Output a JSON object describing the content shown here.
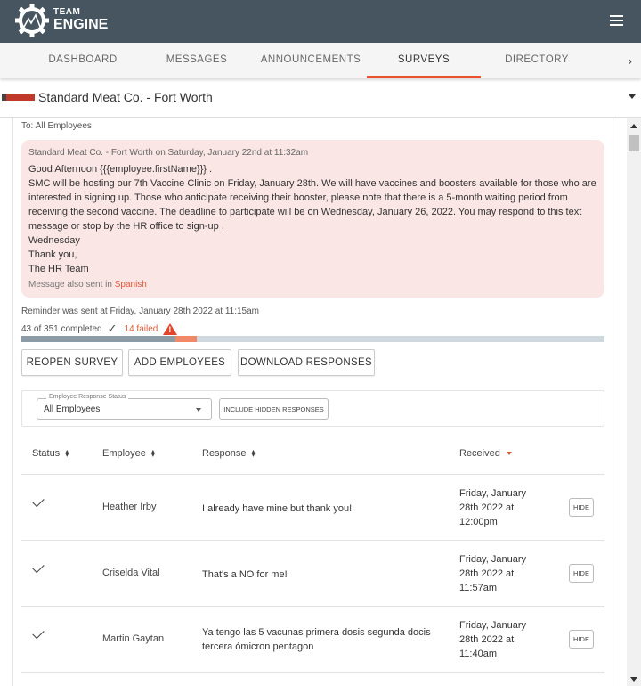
{
  "header": {
    "logo_line1": "TEAM",
    "logo_line2": "ENGINE",
    "menu_icon": "hamburger-icon"
  },
  "tabs": [
    {
      "label": "DASHBOARD",
      "active": false
    },
    {
      "label": "MESSAGES",
      "active": false
    },
    {
      "label": "ANNOUNCEMENTS",
      "active": false
    },
    {
      "label": "SURVEYS",
      "active": true
    },
    {
      "label": "DIRECTORY",
      "active": false
    }
  ],
  "tab_next_label": "›",
  "company": {
    "name": "Standard Meat Co. - Fort Worth"
  },
  "survey": {
    "to": "To: All Employees",
    "message": {
      "meta": "Standard Meat Co. - Fort Worth on Saturday, January 22nd at 11:32am",
      "lines": [
        "Good Afternoon {{{employee.firstName}}} .",
        "SMC will be hosting our 7th Vaccine Clinic on Friday, January 28th. We will have vaccines and boosters available for those who are interested in signing up. Those who anticipate receiving their booster, please note that there is a 5-month waiting period from receiving the second vaccine. The deadline to participate will be on Wednesday, January 26, 2022. You may respond to this text message or stop by the HR office to sign-up .",
        "Wednesday",
        "Thank you,",
        "The HR Team"
      ],
      "also_sent_prefix": "Message also sent in ",
      "also_sent_language": "Spanish"
    },
    "reminder": "Reminder was sent at Friday, January 28th 2022 at 11:15am",
    "completed_text": "43 of 351 completed",
    "failed_text": "14 failed",
    "progress": {
      "completed": 43,
      "failed": 14,
      "total": 351
    },
    "buttons": {
      "reopen": "REOPEN SURVEY",
      "add_employees": "ADD EMPLOYEES",
      "download": "DOWNLOAD RESPONSES"
    },
    "filter": {
      "legend": "Employee Response Status",
      "value": "All Employees",
      "include_hidden": "INCLUDE HIDDEN RESPONSES"
    },
    "table": {
      "columns": [
        "Status",
        "Employee",
        "Response",
        "Received"
      ],
      "rows": [
        {
          "status": "completed",
          "employee": "Heather Irby",
          "response": "I already have mine but thank you!",
          "received": "Friday, January 28th 2022 at 12:00pm",
          "action": "HIDE"
        },
        {
          "status": "completed",
          "employee": "Criselda Vital",
          "response": "That's a NO for me!",
          "received": "Friday, January 28th 2022 at 11:57am",
          "action": "HIDE"
        },
        {
          "status": "completed",
          "employee": "Martin Gaytan",
          "response": "Ya tengo las 5 vacunas primera dosis segunda docis tercera ómicron pentagon",
          "received": "Friday, January 28th 2022 at 11:40am",
          "action": "HIDE"
        }
      ]
    }
  },
  "colors": {
    "header_bg": "#46555f",
    "accent": "#e8532b",
    "message_bg": "#fae6e4",
    "failed": "#e05a3a",
    "progress_completed": "#8c9ba5",
    "progress_failed": "#f28866",
    "progress_track": "#cfd8df"
  }
}
